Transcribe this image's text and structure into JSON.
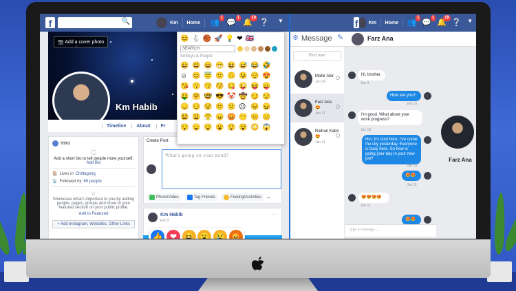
{
  "left_app": {
    "header": {
      "user": "Km",
      "home": "Home",
      "badges": {
        "friends": "1",
        "messages": "1",
        "notifications": "19"
      }
    },
    "cover_button": "Add a cover photo",
    "profile_name": "Km Habib",
    "tabs": [
      "Timeline",
      "About",
      "Fr"
    ],
    "intro": {
      "title": "Intro",
      "bio_text": "Add a short bio to tell people more yourself.",
      "add_bio": "Add Bio",
      "lives": "Lives in ",
      "lives_place": "Chittagong",
      "followed": "Followed by ",
      "followed_count": "65 people",
      "featured_text": "Showcase what's important to you by adding people, pages, groups and more to your featured section on your public profile.",
      "add_featured": "Add to Featured",
      "add_links": "+ Add Instagram, Websites, Other Links"
    },
    "create_post": {
      "label": "Create Post",
      "placeholder": "What's going on your mind?",
      "actions": [
        "Photo/Video",
        "Tag Friends",
        "Feeling/Activities"
      ],
      "more": "..."
    },
    "post": {
      "author": "Km Habib",
      "date": "Feb 9"
    },
    "reactions": [
      "👍",
      "❤",
      "😆",
      "😮",
      "😢",
      "😡"
    ],
    "emoji_panel": {
      "tabs": [
        "😊",
        "🐇",
        "🏀",
        "🚀",
        "💡",
        "❤",
        "🇬🇧"
      ],
      "search_placeholder": "SEARCH",
      "category": "Smileys & People",
      "skin_tones": [
        "#f7c948",
        "#f1d9b5",
        "#e0b98e",
        "#c68e5d",
        "#8d5524",
        "#1da1c1"
      ],
      "emojis": [
        "😀",
        "😃",
        "😄",
        "😁",
        "😆",
        "😅",
        "😂",
        "🤣",
        "☺",
        "😊",
        "😇",
        "🙂",
        "🙃",
        "😉",
        "😌",
        "😍",
        "😘",
        "😗",
        "😙",
        "😚",
        "😋",
        "😜",
        "😝",
        "😛",
        "🤑",
        "🤗",
        "🤓",
        "😎",
        "🤡",
        "🤠",
        "😏",
        "😒",
        "😞",
        "😔",
        "😟",
        "😕",
        "🙁",
        "☹",
        "😣",
        "😖",
        "😫",
        "😩",
        "😤",
        "😠",
        "😡",
        "😶",
        "😐",
        "😑",
        "😯",
        "😦",
        "😧",
        "😮",
        "😲",
        "😵",
        "😳",
        "😱"
      ]
    }
  },
  "right_app": {
    "header": {
      "user": "Km",
      "home": "Home",
      "badges": {
        "friends": "1",
        "messages": "1",
        "notifications": "19"
      }
    },
    "title": "Message",
    "chat_with": "Farz Ana",
    "find_user": "Find user",
    "contacts": [
      {
        "name": "Mahir Abir",
        "time": "Jan 14",
        "emoji": ""
      },
      {
        "name": "Farz Ana",
        "time": "Jan 11",
        "emoji": "😍"
      },
      {
        "name": "Raihan Kabir",
        "time": "Jan 11",
        "emoji": "😍"
      }
    ],
    "messages": [
      {
        "dir": "in",
        "text": "Hi, brother.",
        "time": "Jan 3"
      },
      {
        "dir": "out",
        "text": "How are you?",
        "time": "Jan 10"
      },
      {
        "dir": "in",
        "text": "I'm good. What about your work progress?",
        "time": "Jan 10"
      },
      {
        "dir": "out",
        "text": "Hm, It's cool here. I've come the city yesterday. Everyone is busy here. So how is going your day in your new job?",
        "time": "Jan 10"
      },
      {
        "dir": "out",
        "text": "😍😍",
        "time": "Jan 11"
      },
      {
        "dir": "in",
        "text": "😍😍😍😍",
        "time": "Jan 11"
      },
      {
        "dir": "out",
        "text": "😍😍",
        "time": "Jan 11"
      }
    ],
    "input_placeholder": "type a message.....",
    "profile_name": "Farz Ana"
  },
  "colors": {
    "brand": "#3b5998",
    "accent": "#1e88e5",
    "badge": "#fa3e3e"
  }
}
